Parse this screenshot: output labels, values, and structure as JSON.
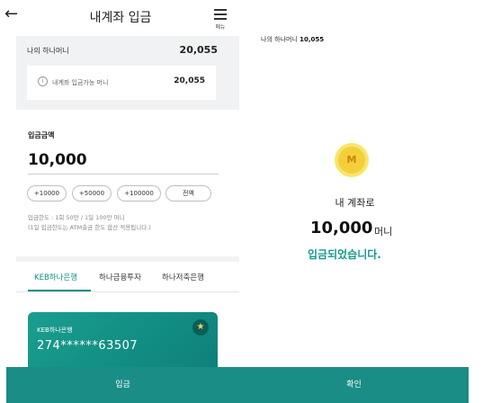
{
  "left": {
    "header": {
      "back_glyph": "←",
      "title": "내계좌 입금",
      "menu_label": "메뉴"
    },
    "wallet": {
      "label": "나의 하나머니",
      "value": "20,055"
    },
    "available": {
      "label": "내계좌 입금가능 머니",
      "value": "20,055"
    },
    "amount": {
      "label": "입금금액",
      "value": "10,000"
    },
    "chips": [
      "+10000",
      "+50000",
      "+100000",
      "전액"
    ],
    "limit": {
      "line1": "입금한도 : 1회 50만 / 1일 100만 머니",
      "line2": "(1일 입금한도는 ATM출금 한도 합산 적용됩니다.)"
    },
    "tabs": [
      "KEB하나은행",
      "하나금융투자",
      "하나저축은행"
    ],
    "card": {
      "bank": "KEB하나은행",
      "account": "274******63507",
      "star": "★"
    },
    "deposit_button": "입금"
  },
  "right": {
    "wallet_label": "나의 하나머니",
    "wallet_value": "10,055",
    "coin_symbol": "M",
    "line1": "내 계좌로",
    "amount": "10,000",
    "unit": "머니",
    "done": "입금되었습니다.",
    "confirm_button": "확인"
  },
  "colors": {
    "accent": "#1a8d86",
    "tab_active": "#0f8f88",
    "coin": "#f2cf3b"
  }
}
